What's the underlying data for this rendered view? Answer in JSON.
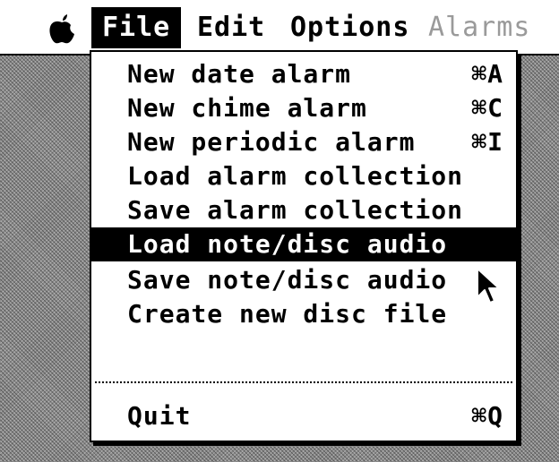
{
  "menubar": {
    "apple": "apple-logo-icon",
    "file": "File",
    "edit": "Edit",
    "options": "Options",
    "alarms": "Alarms"
  },
  "file_menu": {
    "items": [
      {
        "label": "New date alarm",
        "shortcut": "⌘A"
      },
      {
        "label": "New chime alarm",
        "shortcut": "⌘C"
      },
      {
        "label": "New periodic alarm",
        "shortcut": "⌘I"
      },
      {
        "label": "Load alarm collection",
        "shortcut": ""
      },
      {
        "label": "Save alarm collection",
        "shortcut": ""
      },
      {
        "label": "Load note/disc audio",
        "shortcut": "",
        "highlighted": true
      },
      {
        "label": "Save note/disc audio",
        "shortcut": ""
      },
      {
        "label": "Create new disc file",
        "shortcut": ""
      }
    ],
    "quit": {
      "label": "Quit",
      "shortcut": "⌘Q"
    }
  },
  "cursor": "arrow-pointer-icon",
  "colors": {
    "highlight_bg": "#000000",
    "highlight_fg": "#ffffff",
    "disabled": "#9a9a9a"
  }
}
